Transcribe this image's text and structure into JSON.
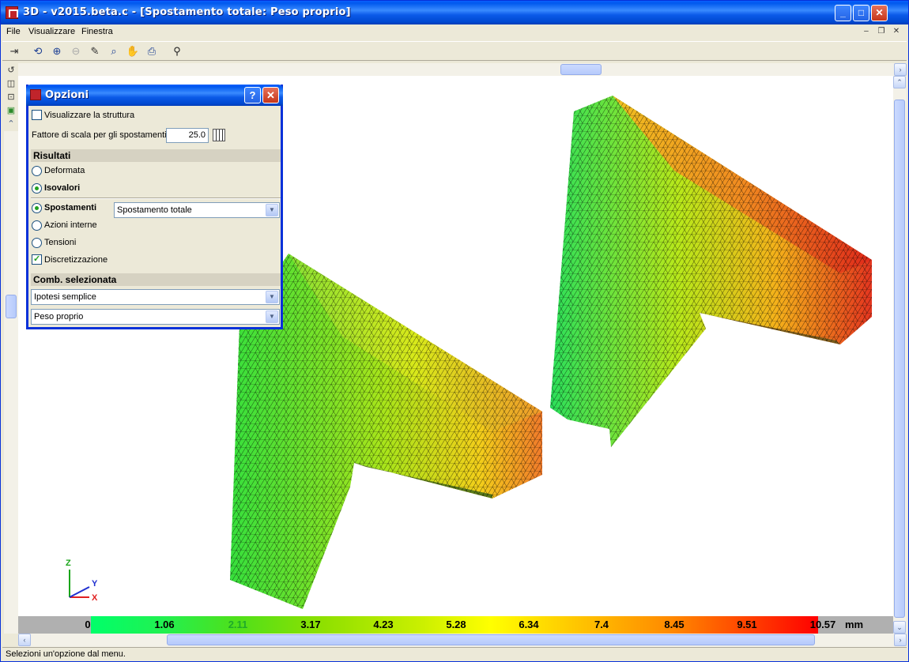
{
  "window": {
    "title": "3D - v2015.beta.c - [Spostamento totale: Peso proprio]"
  },
  "menu": {
    "items": [
      "File",
      "Visualizzare",
      "Finestra"
    ]
  },
  "dialog": {
    "title": "Opzioni",
    "show_structure_label": "Visualizzare la struttura",
    "show_structure_checked": false,
    "scale_factor_label": "Fattore di scala per gli spostamenti",
    "scale_factor_value": "25.0",
    "results_header": "Risultati",
    "deformed_label": "Deformata",
    "isovalues_label": "Isovalori",
    "displacements_label": "Spostamenti",
    "displacement_type": "Spostamento totale",
    "internal_actions_label": "Azioni interne",
    "stresses_label": "Tensioni",
    "discretization_label": "Discretizzazione",
    "discretization_checked": true,
    "combination_header": "Comb. selezionata",
    "hypothesis_type": "Ipotesi semplice",
    "load_case": "Peso proprio"
  },
  "scale": {
    "labels": [
      "0",
      "1.06",
      "2.11",
      "3.17",
      "4.23",
      "5.28",
      "6.34",
      "7.4",
      "8.45",
      "9.51",
      "10.57"
    ],
    "unit": "mm",
    "colors": [
      "#00ff6a",
      "#4fe01a",
      "#c8ef00",
      "#ffff00",
      "#ffc000",
      "#ff8800",
      "#ff0000"
    ]
  },
  "axes": {
    "x": "X",
    "y": "Y",
    "z": "Z"
  },
  "status": {
    "text": "Selezioni un'opzione dal menu."
  }
}
